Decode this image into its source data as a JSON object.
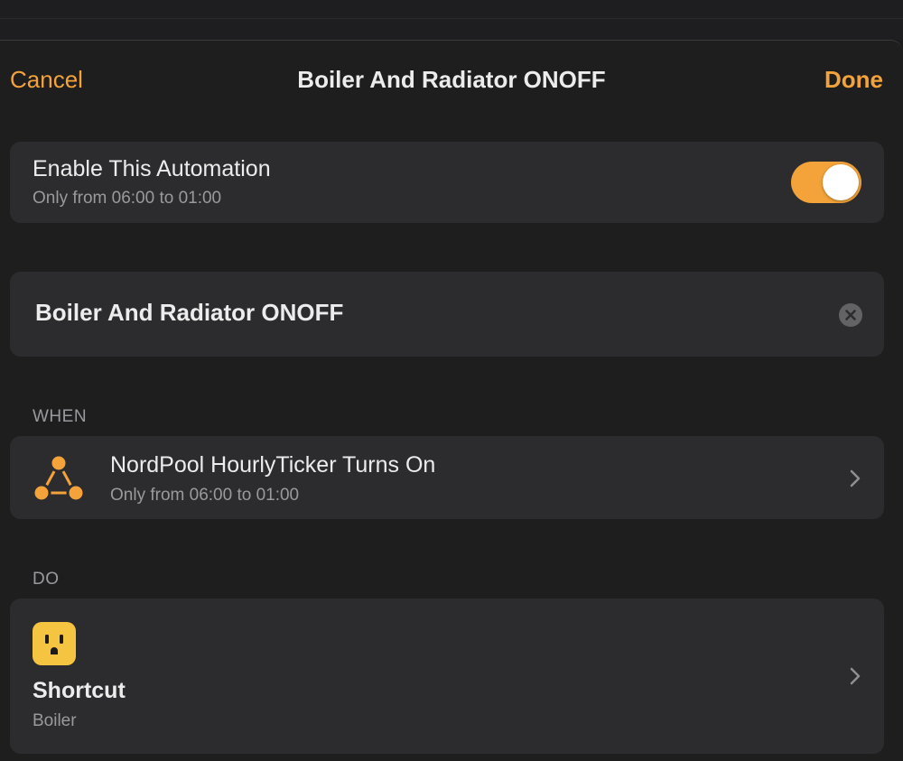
{
  "nav": {
    "cancel_label": "Cancel",
    "title": "Boiler And Radiator ONOFF",
    "done_label": "Done"
  },
  "enable": {
    "title": "Enable This Automation",
    "subtitle": "Only from 06:00 to 01:00",
    "enabled": true
  },
  "name_field": {
    "value": "Boiler And Radiator ONOFF"
  },
  "when": {
    "section_label": "WHEN",
    "trigger_title": "NordPool HourlyTicker Turns On",
    "trigger_subtitle": "Only from 06:00 to 01:00",
    "icon": "automation-trigger-icon"
  },
  "do": {
    "section_label": "DO",
    "action_title": "Shortcut",
    "action_subtitle": "Boiler",
    "icon": "outlet-icon"
  },
  "colors": {
    "accent": "#f3a33a",
    "background": "#1e1e1e",
    "card": "#2c2c2e",
    "outlet_icon_bg": "#f5c542"
  }
}
